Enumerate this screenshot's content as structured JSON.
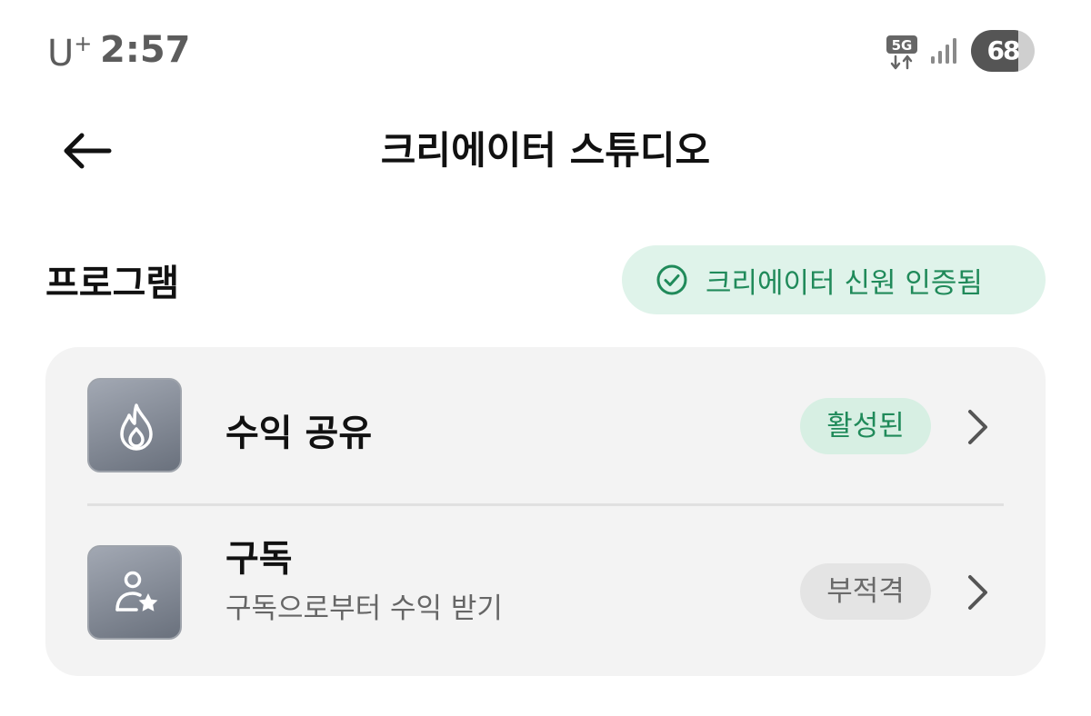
{
  "status_bar": {
    "carrier": "U",
    "carrier_plus": "+",
    "time": "2:57",
    "network_label": "5G",
    "battery_level": "68",
    "icons": [
      "5g-network-icon",
      "signal-strength-icon",
      "battery-icon"
    ]
  },
  "app_bar": {
    "title": "크리에이터 스튜디오",
    "back_icon": "arrow-left-icon"
  },
  "section": {
    "title": "프로그램",
    "verified_badge": {
      "label": "크리에이터 신원 인증됨",
      "icon": "check-circle-icon",
      "color": "#208a5a",
      "background": "#dff3ea"
    }
  },
  "programs": [
    {
      "title": "수익 공유",
      "subtitle": "",
      "icon": "flame-icon",
      "status": "활성된",
      "status_color": "#208a5a",
      "chevron": "chevron-right-icon"
    },
    {
      "title": "구독",
      "subtitle": "구독으로부터 수익 받기",
      "icon": "person-star-icon",
      "status": "부적격",
      "status_color": "#6a6a6a",
      "chevron": "chevron-right-icon"
    }
  ]
}
